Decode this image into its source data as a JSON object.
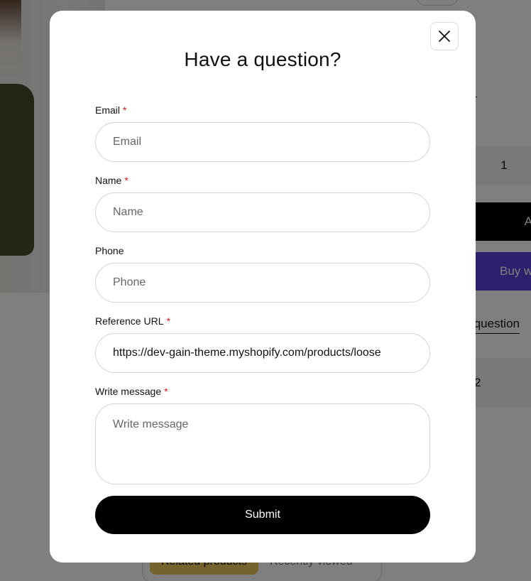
{
  "background": {
    "quantity_value": "1",
    "add_to_cart_label": "A",
    "buy_now_label": "Buy w",
    "ask_question_link": "question",
    "info_value": "2",
    "tabs": [
      "Related products",
      "Recently viewed"
    ]
  },
  "modal": {
    "title": "Have a question?",
    "close_icon": "close-icon",
    "required_marker": "*",
    "fields": {
      "email": {
        "label": "Email",
        "placeholder": "Email",
        "value": ""
      },
      "name": {
        "label": "Name",
        "placeholder": "Name",
        "value": ""
      },
      "phone": {
        "label": "Phone",
        "placeholder": "Phone",
        "value": ""
      },
      "reference_url": {
        "label": "Reference URL",
        "placeholder": "Reference URL",
        "value": "https://dev-gain-theme.myshopify.com/products/loose"
      },
      "message": {
        "label": "Write message",
        "placeholder": "Write message",
        "value": ""
      }
    },
    "submit_label": "Submit"
  },
  "colors": {
    "required": "#d11a1a",
    "primary_button": "#000000",
    "buy_now": "#5a3fd8",
    "tab_active": "#e8c65a"
  }
}
